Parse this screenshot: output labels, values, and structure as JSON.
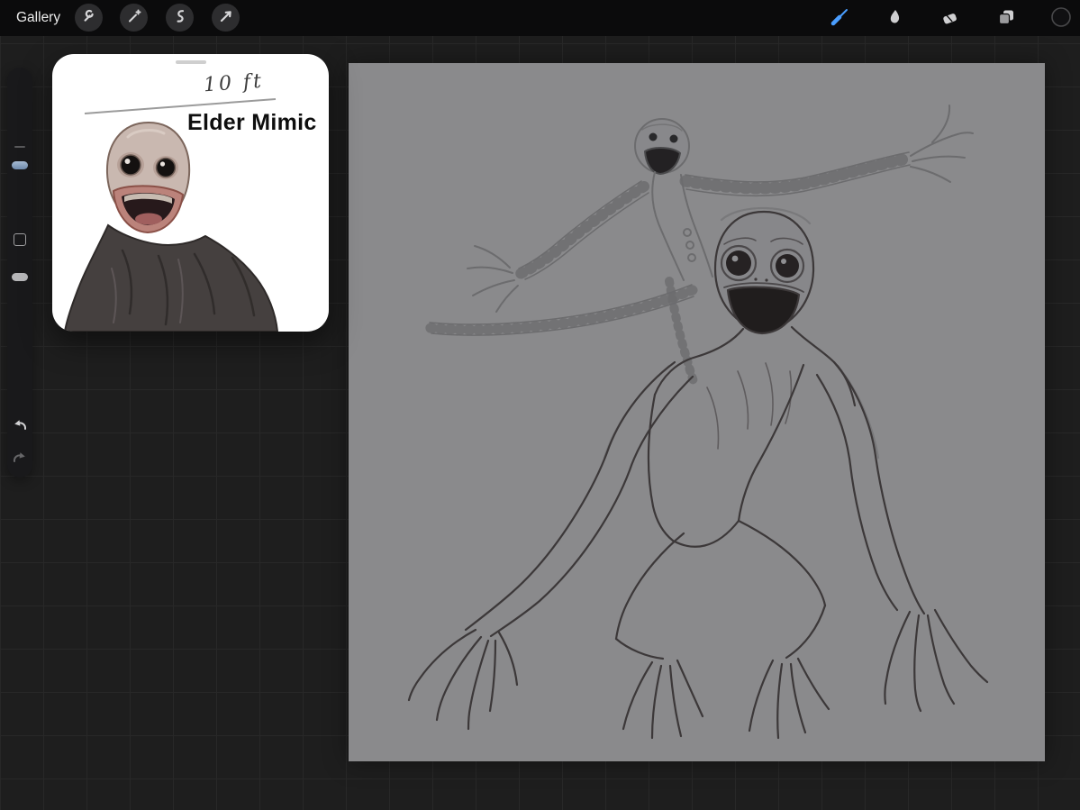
{
  "topbar": {
    "gallery_label": "Gallery",
    "left_tools": [
      {
        "name": "actions",
        "icon": "wrench-icon"
      },
      {
        "name": "adjustments",
        "icon": "magic-wand-icon"
      },
      {
        "name": "selection",
        "icon": "selection-s-icon"
      },
      {
        "name": "transform",
        "icon": "transform-arrow-icon"
      }
    ],
    "right_tools": [
      {
        "name": "paint",
        "icon": "brush-icon",
        "active": true
      },
      {
        "name": "smudge",
        "icon": "smudge-icon",
        "active": false
      },
      {
        "name": "erase",
        "icon": "eraser-icon",
        "active": false
      },
      {
        "name": "layers",
        "icon": "layers-icon",
        "active": false
      },
      {
        "name": "color",
        "icon": "color-swatch-icon",
        "swatch_color": "#101012"
      }
    ],
    "accent_color": "#4a9eff"
  },
  "sidebar": {
    "items": [
      "brush-size-slider",
      "modify-button",
      "opacity-slider",
      "undo-button",
      "redo-button"
    ],
    "brush_size_handle_color": "#7e97b5",
    "opacity_handle_color": "#b6b6b8"
  },
  "reference_panel": {
    "height_label": "10 ft",
    "title": "Elder Mimic"
  },
  "canvas": {
    "background_color": "#8a8a8c",
    "content": "graphite sketch of a two-headed elder mimic creature with long clawed limbs"
  }
}
